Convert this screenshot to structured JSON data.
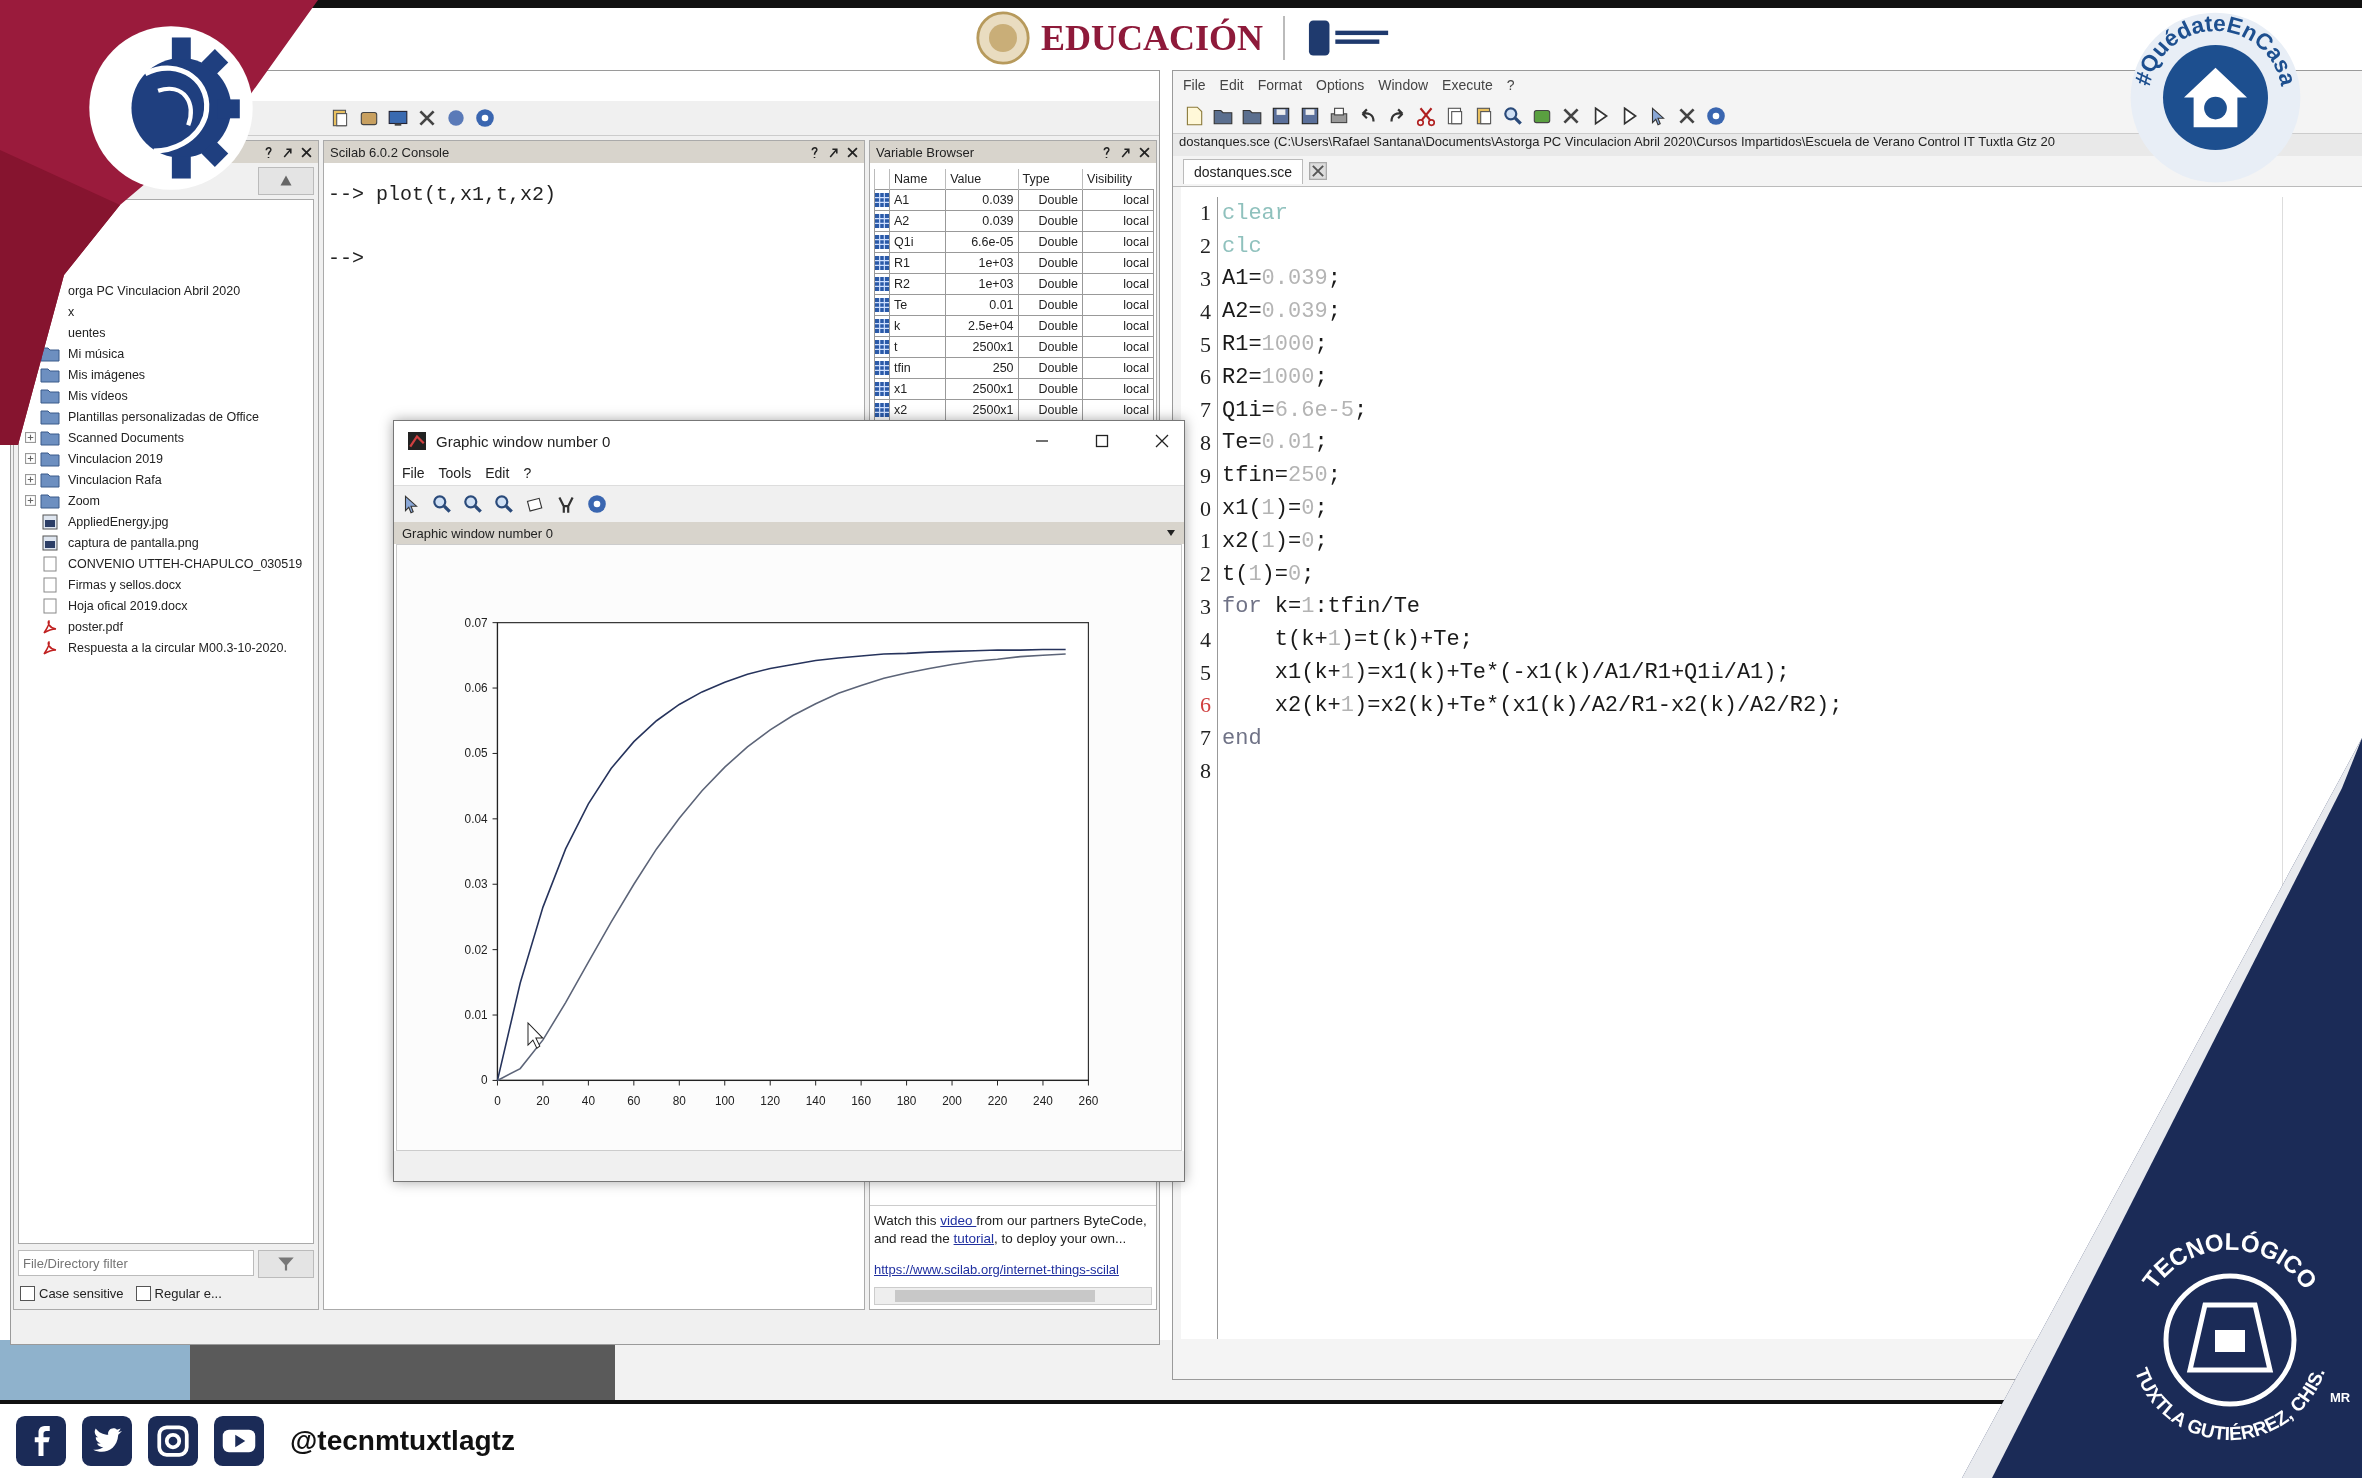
{
  "header": {
    "logo_text": "EDUCACIÓN"
  },
  "badge": {
    "text": "#QuédateEnCasa"
  },
  "emblem": {
    "line_1": "TECNOLÓGICO",
    "line_2": "TUXTLA GUTIÉRREZ, CHIS.",
    "mark": "MR"
  },
  "console_window": {
    "file_browser": {
      "items": [
        {
          "label": "orga PC Vinculacion Abril 2020",
          "kind": "cut",
          "expandable": false
        },
        {
          "label": "x",
          "kind": "cut",
          "expandable": false
        },
        {
          "label": "uentes",
          "kind": "cut",
          "expandable": false
        },
        {
          "label": "Mi música",
          "kind": "folder",
          "expandable": false
        },
        {
          "label": "Mis imágenes",
          "kind": "folder",
          "expandable": false
        },
        {
          "label": "Mis vídeos",
          "kind": "folder",
          "expandable": false
        },
        {
          "label": "Plantillas personalizadas de Office",
          "kind": "folder",
          "expandable": false
        },
        {
          "label": "Scanned Documents",
          "kind": "folder",
          "expandable": true
        },
        {
          "label": "Vinculacion 2019",
          "kind": "folder",
          "expandable": true
        },
        {
          "label": "Vinculacion Rafa",
          "kind": "folder",
          "expandable": true
        },
        {
          "label": "Zoom",
          "kind": "folder",
          "expandable": true
        },
        {
          "label": "AppliedEnergy.jpg",
          "kind": "image",
          "expandable": false
        },
        {
          "label": "captura de pantalla.png",
          "kind": "image",
          "expandable": false
        },
        {
          "label": "CONVENIO UTTEH-CHAPULCO_030519",
          "kind": "file",
          "expandable": false
        },
        {
          "label": "Firmas y sellos.docx",
          "kind": "file",
          "expandable": false
        },
        {
          "label": "Hoja ofical 2019.docx",
          "kind": "file",
          "expandable": false
        },
        {
          "label": "poster.pdf",
          "kind": "pdf",
          "expandable": false
        },
        {
          "label": "Respuesta a la circular M00.3-10-2020.",
          "kind": "pdf",
          "expandable": false
        }
      ],
      "filter": {
        "placeholder": "File/Directory filter"
      },
      "options": [
        {
          "label": "Case sensitive",
          "checked": false
        },
        {
          "label": "Regular e...",
          "checked": false
        }
      ]
    },
    "console": {
      "title": "Scilab 6.0.2 Console",
      "lines": [
        "--> plot(t,x1,t,x2)",
        "-->"
      ]
    },
    "variable_browser": {
      "title": "Variable Browser",
      "columns": [
        "Name",
        "Value",
        "Type",
        "Visibility"
      ],
      "rows": [
        [
          "A1",
          "0.039",
          "Double",
          "local"
        ],
        [
          "A2",
          "0.039",
          "Double",
          "local"
        ],
        [
          "Q1i",
          "6.6e-05",
          "Double",
          "local"
        ],
        [
          "R1",
          "1e+03",
          "Double",
          "local"
        ],
        [
          "R2",
          "1e+03",
          "Double",
          "local"
        ],
        [
          "Te",
          "0.01",
          "Double",
          "local"
        ],
        [
          "k",
          "2.5e+04",
          "Double",
          "local"
        ],
        [
          "t",
          "2500x1",
          "Double",
          "local"
        ],
        [
          "tfin",
          "250",
          "Double",
          "local"
        ],
        [
          "x1",
          "2500x1",
          "Double",
          "local"
        ],
        [
          "x2",
          "2500x1",
          "Double",
          "local"
        ]
      ]
    },
    "news_feed": {
      "parts": [
        {
          "text": "Watch this ",
          "kind": "text"
        },
        {
          "text": "video ",
          "kind": "link"
        },
        {
          "text": "from our partners ByteCode, and read the ",
          "kind": "text"
        },
        {
          "text": "tutorial",
          "kind": "link"
        },
        {
          "text": ", to deploy your own...",
          "kind": "text"
        }
      ],
      "url": "https://www.scilab.org/internet-things-scilal"
    }
  },
  "editor": {
    "menu": [
      "File",
      "Edit",
      "Format",
      "Options",
      "Window",
      "Execute",
      "?"
    ],
    "path": "dostanques.sce (C:\\Users\\Rafael Santana\\Documents\\Astorga PC Vinculacion Abril 2020\\Cursos Impartidos\\Escuela de Verano Control IT Tuxtla Gtz 20",
    "tab": {
      "label": "dostanques.sce"
    },
    "lines": [
      {
        "number": "1",
        "current": false,
        "segments": [
          {
            "text": "clear",
            "kind": "command"
          }
        ]
      },
      {
        "number": "2",
        "current": false,
        "segments": [
          {
            "text": "clc",
            "kind": "command"
          }
        ]
      },
      {
        "number": "3",
        "current": false,
        "segments": [
          {
            "text": "A1=",
            "kind": "plain"
          },
          {
            "text": "0.039",
            "kind": "number"
          },
          {
            "text": ";",
            "kind": "plain"
          }
        ]
      },
      {
        "number": "4",
        "current": false,
        "segments": [
          {
            "text": "A2=",
            "kind": "plain"
          },
          {
            "text": "0.039",
            "kind": "number"
          },
          {
            "text": ";",
            "kind": "plain"
          }
        ]
      },
      {
        "number": "5",
        "current": false,
        "segments": [
          {
            "text": "R1=",
            "kind": "plain"
          },
          {
            "text": "1000",
            "kind": "number"
          },
          {
            "text": ";",
            "kind": "plain"
          }
        ]
      },
      {
        "number": "6",
        "current": false,
        "segments": [
          {
            "text": "R2=",
            "kind": "plain"
          },
          {
            "text": "1000",
            "kind": "number"
          },
          {
            "text": ";",
            "kind": "plain"
          }
        ]
      },
      {
        "number": "7",
        "current": false,
        "segments": [
          {
            "text": "Q1i=",
            "kind": "plain"
          },
          {
            "text": "6.6e-5",
            "kind": "number"
          },
          {
            "text": ";",
            "kind": "plain"
          }
        ]
      },
      {
        "number": "8",
        "current": false,
        "segments": [
          {
            "text": "Te=",
            "kind": "plain"
          },
          {
            "text": "0.01",
            "kind": "number"
          },
          {
            "text": ";",
            "kind": "plain"
          }
        ]
      },
      {
        "number": "9",
        "current": false,
        "segments": [
          {
            "text": "tfin=",
            "kind": "plain"
          },
          {
            "text": "250",
            "kind": "number"
          },
          {
            "text": ";",
            "kind": "plain"
          }
        ]
      },
      {
        "number": "0",
        "current": false,
        "segments": [
          {
            "text": "x1(",
            "kind": "plain"
          },
          {
            "text": "1",
            "kind": "number"
          },
          {
            "text": ")=",
            "kind": "plain"
          },
          {
            "text": "0",
            "kind": "number"
          },
          {
            "text": ";",
            "kind": "plain"
          }
        ]
      },
      {
        "number": "1",
        "current": false,
        "segments": [
          {
            "text": "x2(",
            "kind": "plain"
          },
          {
            "text": "1",
            "kind": "number"
          },
          {
            "text": ")=",
            "kind": "plain"
          },
          {
            "text": "0",
            "kind": "number"
          },
          {
            "text": ";",
            "kind": "plain"
          }
        ]
      },
      {
        "number": "2",
        "current": false,
        "segments": [
          {
            "text": "t(",
            "kind": "plain"
          },
          {
            "text": "1",
            "kind": "number"
          },
          {
            "text": ")=",
            "kind": "plain"
          },
          {
            "text": "0",
            "kind": "number"
          },
          {
            "text": ";",
            "kind": "plain"
          }
        ]
      },
      {
        "number": "3",
        "current": false,
        "segments": [
          {
            "text": "for",
            "kind": "keyword"
          },
          {
            "text": " k=",
            "kind": "plain"
          },
          {
            "text": "1",
            "kind": "number"
          },
          {
            "text": ":tfin/Te",
            "kind": "plain"
          }
        ]
      },
      {
        "number": "4",
        "current": false,
        "segments": [
          {
            "text": "    t(k+",
            "kind": "plain"
          },
          {
            "text": "1",
            "kind": "number"
          },
          {
            "text": ")=t(k)+Te;",
            "kind": "plain"
          }
        ]
      },
      {
        "number": "5",
        "current": false,
        "segments": [
          {
            "text": "    x1(k+",
            "kind": "plain"
          },
          {
            "text": "1",
            "kind": "number"
          },
          {
            "text": ")=x1(k)+Te*(-x1(k)/A1/R1+Q1i/A1);",
            "kind": "plain"
          }
        ]
      },
      {
        "number": "6",
        "current": true,
        "segments": [
          {
            "text": "    x2(k+",
            "kind": "plain"
          },
          {
            "text": "1",
            "kind": "number"
          },
          {
            "text": ")=x2(k)+Te*(x1(k)/A2/R1-x2(k)/A2/R2);",
            "kind": "plain"
          }
        ]
      },
      {
        "number": "7",
        "current": false,
        "segments": [
          {
            "text": "end",
            "kind": "keyword"
          }
        ]
      },
      {
        "number": "8",
        "current": false
      }
    ]
  },
  "graphic_window": {
    "title": "Graphic window number 0",
    "menu": [
      "File",
      "Tools",
      "Edit",
      "?"
    ],
    "subtitle": "Graphic window number 0",
    "chart_data": {
      "type": "line",
      "x": [
        0,
        10,
        20,
        30,
        40,
        50,
        60,
        70,
        80,
        90,
        100,
        110,
        120,
        130,
        140,
        150,
        160,
        170,
        180,
        190,
        200,
        210,
        220,
        230,
        240,
        250
      ],
      "series": [
        {
          "color": "#26335c",
          "values": [
            0,
            0.0149,
            0.0265,
            0.0354,
            0.0423,
            0.0477,
            0.0518,
            0.055,
            0.0575,
            0.0594,
            0.0609,
            0.0621,
            0.063,
            0.0636,
            0.0642,
            0.0646,
            0.0649,
            0.0652,
            0.0653,
            0.0655,
            0.0656,
            0.0657,
            0.0658,
            0.0658,
            0.0659,
            0.0659
          ]
        },
        {
          "color": "#5c6478",
          "values": [
            0,
            0.0018,
            0.0062,
            0.0119,
            0.0181,
            0.0242,
            0.03,
            0.0354,
            0.0401,
            0.0443,
            0.0479,
            0.051,
            0.0536,
            0.0558,
            0.0576,
            0.0592,
            0.0604,
            0.0615,
            0.0623,
            0.063,
            0.0636,
            0.0641,
            0.0644,
            0.0648,
            0.065,
            0.0652
          ]
        }
      ],
      "xlim": [
        0,
        260
      ],
      "ylim": [
        0,
        0.07
      ],
      "xticks": [
        0,
        20,
        40,
        60,
        80,
        100,
        120,
        140,
        160,
        180,
        200,
        220,
        240,
        260
      ],
      "yticks": [
        0,
        0.01,
        0.02,
        0.03,
        0.04,
        0.05,
        0.06,
        0.07
      ]
    }
  },
  "footer": {
    "handle": "@tecnmtuxtlagtz"
  }
}
